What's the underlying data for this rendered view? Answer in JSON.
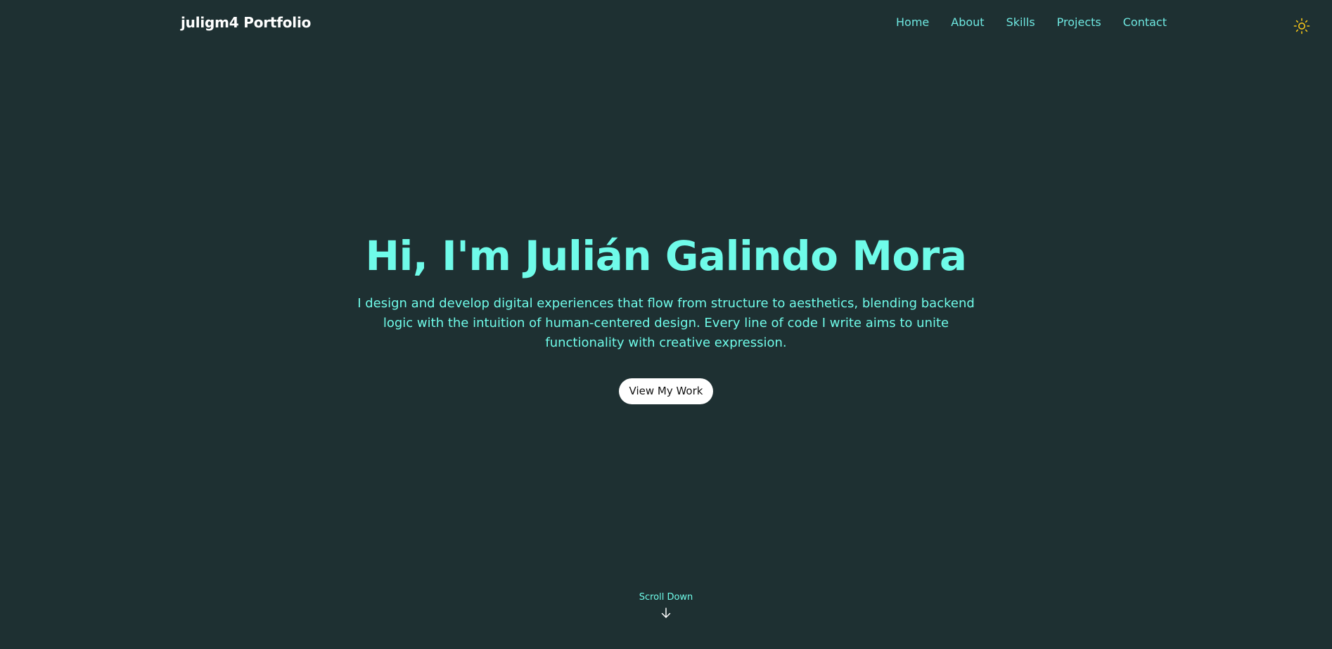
{
  "navbar": {
    "brand": "juligm4 Portfolio",
    "links": [
      {
        "label": "Home"
      },
      {
        "label": "About"
      },
      {
        "label": "Skills"
      },
      {
        "label": "Projects"
      },
      {
        "label": "Contact"
      }
    ],
    "theme_toggle_icon": "sun-icon"
  },
  "hero": {
    "title": "Hi, I'm Julián Galindo Mora",
    "subtitle": "I design and develop digital experiences that flow from structure to aesthetics, blending backend logic with the intuition of human-centered design. Every line of code I write aims to unite functionality with creative expression.",
    "cta_label": "View My Work"
  },
  "scroll": {
    "label": "Scroll Down",
    "icon": "arrow-down-icon"
  },
  "colors": {
    "background": "#1e3032",
    "accent": "#6ffbe9",
    "nav_link": "#6ee7e0",
    "sun": "#f5c518"
  }
}
